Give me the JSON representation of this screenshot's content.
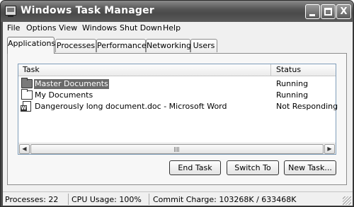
{
  "window": {
    "title": "Windows Task Manager",
    "controls": {
      "minimize": "",
      "maximize": "",
      "close": "X"
    }
  },
  "menu": [
    "File",
    "Options",
    "View",
    "Windows",
    "Shut Down",
    "Help"
  ],
  "tabs": [
    {
      "label": "Applications",
      "active": true
    },
    {
      "label": "Processes",
      "active": false
    },
    {
      "label": "Performance",
      "active": false
    },
    {
      "label": "Networking",
      "active": false
    },
    {
      "label": "Users",
      "active": false
    }
  ],
  "task_list": {
    "columns": [
      "Task",
      "Status"
    ],
    "rows": [
      {
        "icon": "folder-icon",
        "task": "Master Documents",
        "status": "Running",
        "selected": true
      },
      {
        "icon": "folder-open-icon",
        "task": "My Documents",
        "status": "Running",
        "selected": false
      },
      {
        "icon": "word-document-icon",
        "task": "Dangerously long document.doc - Microsoft Word",
        "status": "Not Responding",
        "selected": false
      }
    ]
  },
  "buttons": {
    "end_task": "End Task",
    "switch_to": "Switch To",
    "new_task": "New Task..."
  },
  "statusbar": {
    "processes": "Processes: 22",
    "cpu": "CPU Usage: 100%",
    "commit": "Commit Charge: 103268K / 633468K"
  },
  "colors": {
    "titlebar": "#4a4a4a",
    "selection": "#6a6a6a",
    "face": "#f0f0f0"
  }
}
